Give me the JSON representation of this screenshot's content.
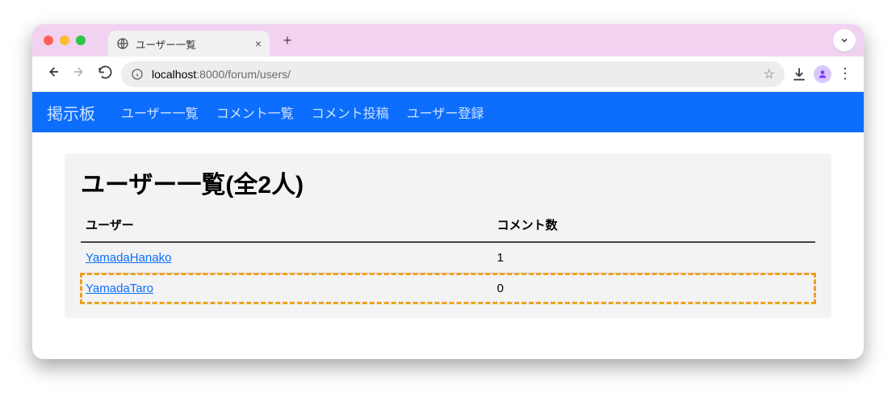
{
  "browser": {
    "tab_title": "ユーザー一覧",
    "url_host": "localhost",
    "url_port": ":8000",
    "url_path": "/forum/users/"
  },
  "nav": {
    "brand": "掲示板",
    "items": [
      "ユーザー一覧",
      "コメント一覧",
      "コメント投稿",
      "ユーザー登録"
    ]
  },
  "page": {
    "heading": "ユーザー一覧(全2人)",
    "columns": {
      "user": "ユーザー",
      "comments": "コメント数"
    },
    "rows": [
      {
        "user": "YamadaHanako",
        "comments": "1",
        "highlight": false
      },
      {
        "user": "YamadaTaro",
        "comments": "0",
        "highlight": true
      }
    ]
  }
}
